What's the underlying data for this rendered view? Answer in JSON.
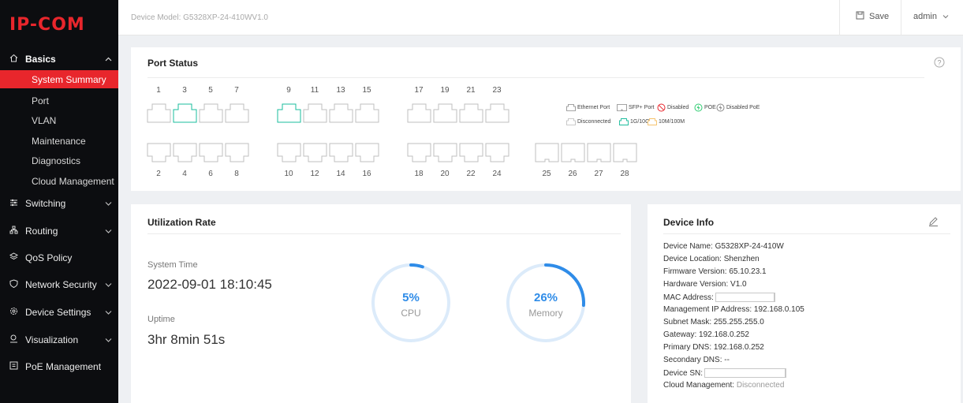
{
  "brand": {
    "logo": "IP-COM",
    "accent": "#e8262c"
  },
  "topbar": {
    "device_model": "Device Model: G5328XP-24-410WV1.0",
    "save_label": "Save",
    "user_label": "admin"
  },
  "sidebar": {
    "basics": {
      "label": "Basics",
      "items": [
        {
          "label": "System Summary",
          "active": true
        },
        {
          "label": "Port"
        },
        {
          "label": "VLAN"
        },
        {
          "label": "Maintenance"
        },
        {
          "label": "Diagnostics"
        },
        {
          "label": "Cloud Management"
        }
      ]
    },
    "groups": [
      {
        "label": "Switching",
        "icon": "sliders-icon",
        "expandable": true
      },
      {
        "label": "Routing",
        "icon": "network-icon",
        "expandable": true
      },
      {
        "label": "QoS Policy",
        "icon": "qos-icon",
        "expandable": false
      },
      {
        "label": "Network Security",
        "icon": "shield-icon",
        "expandable": true
      },
      {
        "label": "Device Settings",
        "icon": "gear-icon",
        "expandable": true
      },
      {
        "label": "Visualization",
        "icon": "visual-icon",
        "expandable": true
      },
      {
        "label": "PoE Management",
        "icon": "poe-icon",
        "expandable": false
      }
    ]
  },
  "port_status": {
    "title": "Port Status",
    "top_ports": [
      "1",
      "3",
      "5",
      "7",
      "9",
      "11",
      "13",
      "15",
      "17",
      "19",
      "21",
      "23"
    ],
    "bottom_ports": [
      "2",
      "4",
      "6",
      "8",
      "10",
      "12",
      "14",
      "16",
      "18",
      "20",
      "22",
      "24"
    ],
    "sfp_ports": [
      "25",
      "26",
      "27",
      "28"
    ],
    "connected_1g": [
      "3",
      "9"
    ],
    "legend": {
      "ethernet": "Ethernet Port",
      "sfp": "SFP+ Port",
      "disabled": "Disabled",
      "poe": "POE",
      "disabled_poe": "Disabled PoE",
      "disconnected": "Disconnected",
      "speed_1g": "1G/10G",
      "speed_10m": "10M/100M"
    },
    "colors": {
      "gig": "#1abc9c",
      "fast": "#f5c26b",
      "disabled": "#e8262c",
      "poe": "#2ecc71",
      "idle": "#bfbfbf"
    }
  },
  "utilization": {
    "title": "Utilization Rate",
    "system_time_label": "System Time",
    "system_time": "2022-09-01 18:10:45",
    "uptime_label": "Uptime",
    "uptime": "3hr 8min 51s",
    "cpu": {
      "percent": 5,
      "percent_text": "5%",
      "label": "CPU"
    },
    "memory": {
      "percent": 26,
      "percent_text": "26%",
      "label": "Memory"
    },
    "colors": {
      "arc": "#2f8ce8",
      "track": "#dcebfa"
    }
  },
  "device_info": {
    "title": "Device Info",
    "device_name": "Device Name: G5328XP-24-410W",
    "device_location": "Device Location: Shenzhen",
    "firmware": "Firmware Version: 65.10.23.1",
    "hardware": "Hardware Version: V1.0",
    "mac_label": "MAC Address:",
    "mgmt_ip": "Management IP Address: 192.168.0.105",
    "subnet": "Subnet Mask: 255.255.255.0",
    "gateway": "Gateway: 192.168.0.252",
    "primary_dns": "Primary DNS: 192.168.0.252",
    "secondary_dns": "Secondary DNS: --",
    "sn_label": "Device SN:",
    "cloud_label": "Cloud Management:",
    "cloud_value": "Disconnected"
  }
}
